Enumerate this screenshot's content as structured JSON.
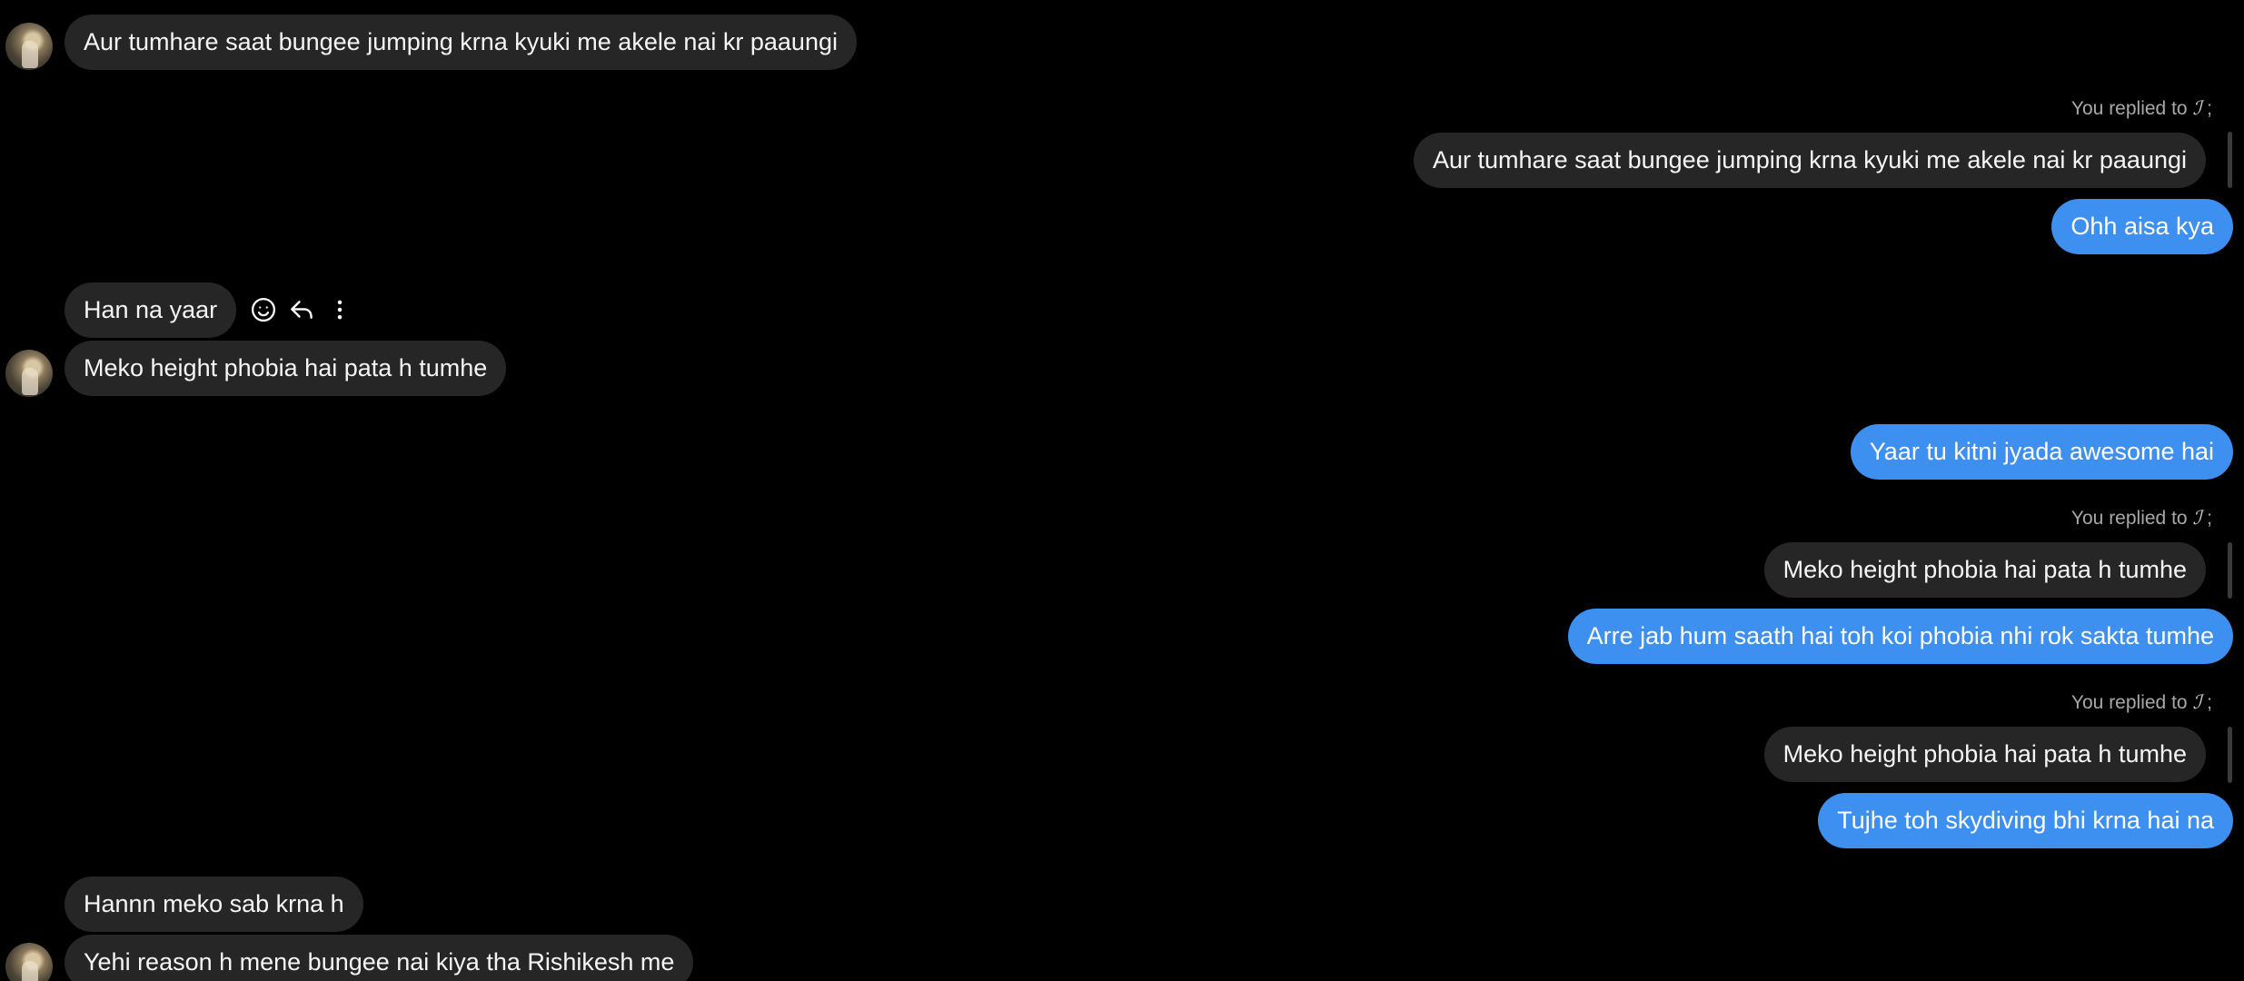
{
  "incoming": [
    {
      "text": "Aur tumhare saat bungee jumping krna kyuki me akele nai kr paaungi"
    },
    {
      "text": "Han na yaar"
    },
    {
      "text": "Meko height phobia hai pata h tumhe"
    },
    {
      "text": "Hannn meko sab krna h"
    },
    {
      "text": "Yehi reason h mene bungee nai kiya tha Rishikesh me"
    }
  ],
  "replies": [
    {
      "label": "You replied to",
      "name": "ℐ",
      "suffix": ";",
      "quote": "Aur tumhare saat bungee jumping krna kyuki me akele nai kr paaungi",
      "text": "Ohh aisa kya"
    },
    {
      "label": "You replied to",
      "name": "ℐ",
      "suffix": ";",
      "quote": "Meko height phobia hai pata h tumhe",
      "text": "Arre jab hum saath hai toh koi phobia nhi rok sakta tumhe"
    },
    {
      "label": "You replied to",
      "name": "ℐ",
      "suffix": ";",
      "quote": "Meko height phobia hai pata h tumhe",
      "text": "Tujhe toh skydiving bhi krna hai na"
    }
  ],
  "outgoing_plain": [
    {
      "text": "Yaar tu kitni jyada awesome hai"
    }
  ],
  "message_actions": {
    "react_icon": "smiley-icon",
    "reply_icon": "reply-icon",
    "more_icon": "more-vertical-icon"
  },
  "colors": {
    "background": "#000000",
    "incoming_bubble": "#262626",
    "outgoing_bubble": "#3d8ff0",
    "meta_text": "#a8a8a8"
  }
}
